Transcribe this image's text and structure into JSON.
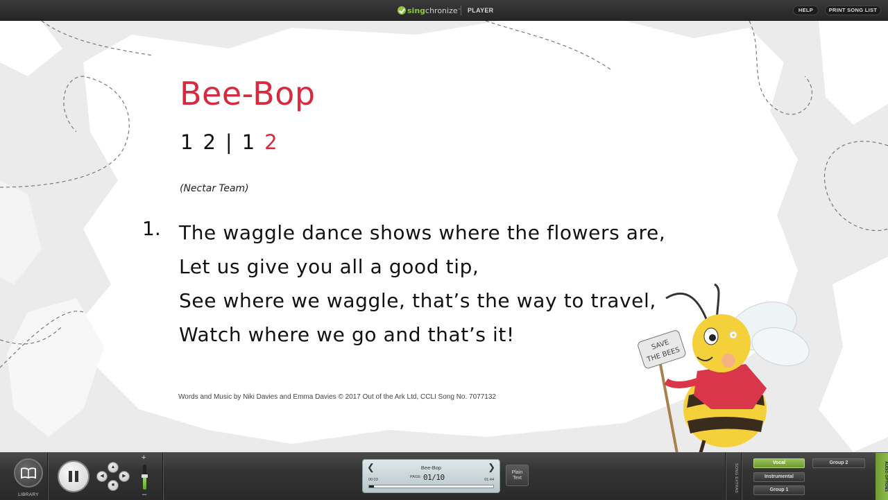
{
  "app": {
    "logo_sing": "sing",
    "logo_chronize": "chronize",
    "logo_tm": "™",
    "player_label": "PLAYER",
    "help_label": "HELP",
    "print_label": "PRINT SONG LIST"
  },
  "slide": {
    "title": "Bee-Bop",
    "counts": [
      "1",
      "2",
      "|",
      "1",
      "2"
    ],
    "team": "(Nectar Team)",
    "verse_number": "1.",
    "lyrics": [
      "The waggle dance shows where the flowers are,",
      "Let us give you all a good tip,",
      "See where we waggle, that’s the way to travel,",
      "Watch where we go and that’s it!"
    ],
    "credit": "Words and Music by Niki Davies and Emma Davies © 2017 Out of the Ark Ltd, CCLI Song No. 7077132",
    "sign_text_1": "SAVE",
    "sign_text_2": "THE BEES"
  },
  "controls": {
    "library_label": "LIBRARY",
    "volume_plus": "+",
    "volume_minus": "–",
    "volume_level": 0.55
  },
  "display": {
    "title": "Bee-Bop",
    "page_label": "PAGE:",
    "page": "01/10",
    "elapsed": "00:03",
    "total": "01:44",
    "progress": 0.04
  },
  "plain_text": {
    "line1": "Plain",
    "line2": "Text"
  },
  "audio": {
    "song_extras_label": "SONG EXTRAS",
    "vocal": "Vocal",
    "instrumental": "Instrumental",
    "group1": "Group 1",
    "group2": "Group 2",
    "audio_options_label": "AUDIO OPTIONS"
  },
  "colors": {
    "title_red": "#d8293f",
    "accent_green": "#8fc43f"
  }
}
